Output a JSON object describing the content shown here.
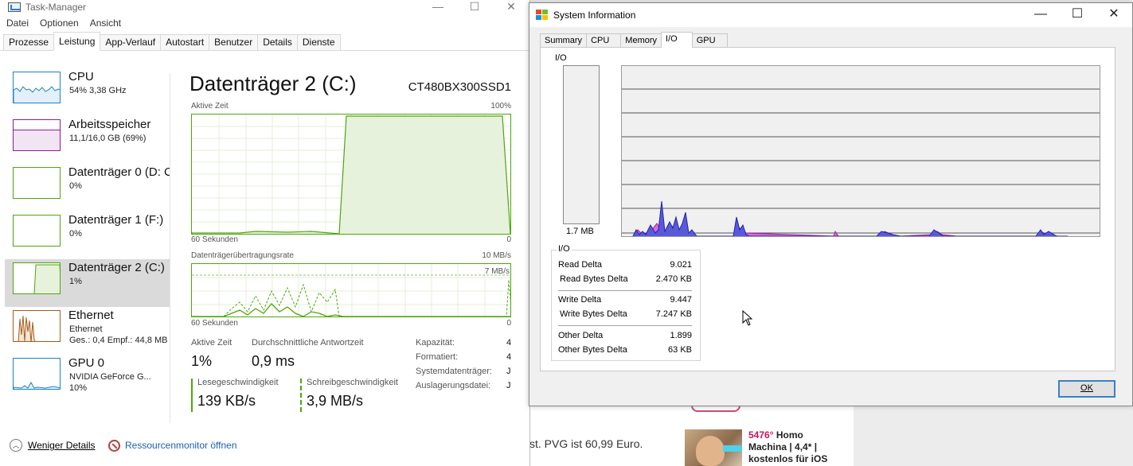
{
  "background": {
    "text": "st. PVG ist 60,99 Euro.",
    "deal_degree": "5476°",
    "deal_text": "Homo Machina | 4,4* | kostenlos für iOS"
  },
  "taskmanager": {
    "title": "Task-Manager",
    "menu": [
      "Datei",
      "Optionen",
      "Ansicht"
    ],
    "tabs": [
      "Prozesse",
      "Leistung",
      "App-Verlauf",
      "Autostart",
      "Benutzer",
      "Details",
      "Dienste"
    ],
    "active_tab": "Leistung",
    "sidebar": [
      {
        "name": "CPU",
        "sub1": "54% 3,38 GHz",
        "sub2": ""
      },
      {
        "name": "Arbeitsspeicher",
        "sub1": "11,1/16,0 GB (69%)",
        "sub2": ""
      },
      {
        "name": "Datenträger 0 (D: C",
        "sub1": "0%",
        "sub2": ""
      },
      {
        "name": "Datenträger 1 (F:)",
        "sub1": "0%",
        "sub2": ""
      },
      {
        "name": "Datenträger 2 (C:)",
        "sub1": "1%",
        "sub2": ""
      },
      {
        "name": "Ethernet",
        "sub1": "Ethernet",
        "sub2": "Ges.: 0,4 Empf.: 44,8 MB"
      },
      {
        "name": "GPU 0",
        "sub1": "NVIDIA GeForce G...",
        "sub2": "10%"
      }
    ],
    "selected_index": 4,
    "main": {
      "title": "Datenträger 2 (C:)",
      "model": "CT480BX300SSD1",
      "graph1_label": "Aktive Zeit",
      "graph1_max": "100%",
      "graph1_time": "60 Sekunden",
      "graph1_min": "0",
      "graph2_label": "Datenträgerübertragungsrate",
      "graph2_max": "10 MB/s",
      "graph2_inner": "7 MB/s",
      "graph2_time": "60 Sekunden",
      "graph2_min": "0",
      "active_time_label": "Aktive Zeit",
      "active_time": "1%",
      "response_label": "Durchschnittliche Antwortzeit",
      "response": "0,9 ms",
      "read_label": "Lesegeschwindigkeit",
      "read": "139 KB/s",
      "write_label": "Schreibgeschwindigkeit",
      "write": "3,9 MB/s",
      "props": [
        {
          "k": "Kapazität:",
          "v": "4"
        },
        {
          "k": "Formatiert:",
          "v": "4"
        },
        {
          "k": "Systemdatenträger:",
          "v": "J"
        },
        {
          "k": "Auslagerungsdatei:",
          "v": "J"
        }
      ]
    },
    "footer": {
      "fewer_details": "Weniger Details",
      "resmon": "Ressourcenmonitor öffnen"
    }
  },
  "sysinfo": {
    "title": "System Information",
    "tabs": [
      "Summary",
      "CPU",
      "Memory",
      "I/O",
      "GPU"
    ],
    "active_tab": "I/O",
    "io_label": "I/O",
    "meter_label": "1.7 MB",
    "group_label": "I/O",
    "rows": [
      {
        "k": "Read Delta",
        "v": "9.021"
      },
      {
        "k": "Read Bytes Delta",
        "v": "2.470 KB"
      },
      {
        "k": "Write Delta",
        "v": "9.447"
      },
      {
        "k": "Write Bytes Delta",
        "v": "7.247 KB"
      },
      {
        "k": "Other Delta",
        "v": "1.899"
      },
      {
        "k": "Other Bytes Delta",
        "v": "63 KB"
      }
    ],
    "ok": "OK"
  }
}
